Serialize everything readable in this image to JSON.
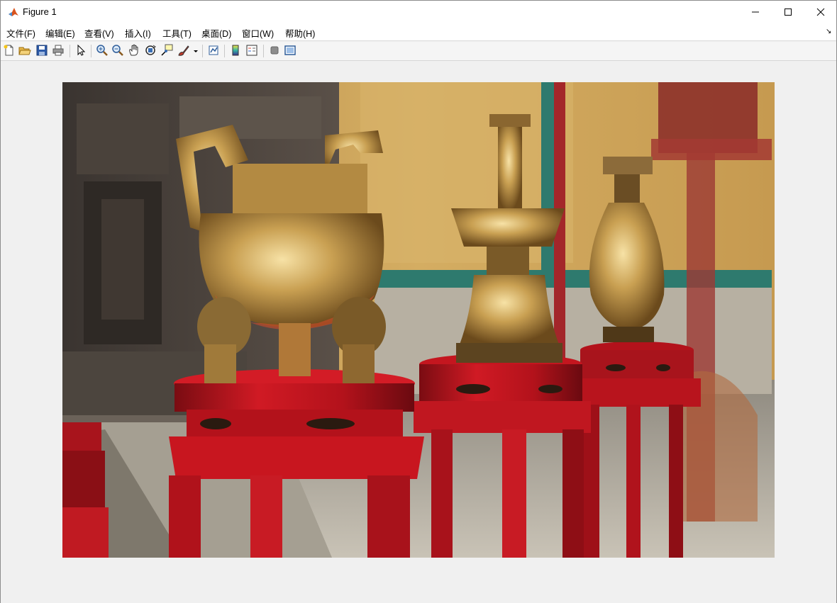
{
  "window": {
    "title": "Figure 1",
    "app_icon": "matlab-icon"
  },
  "menu": {
    "items": [
      {
        "label": "文件(F)"
      },
      {
        "label": "编辑(E)"
      },
      {
        "label": "查看(V)"
      },
      {
        "label": "插入(I)"
      },
      {
        "label": "工具(T)"
      },
      {
        "label": "桌面(D)"
      },
      {
        "label": "窗口(W)"
      },
      {
        "label": "帮助(H)"
      }
    ],
    "dock_arrow": "↘"
  },
  "toolbar": {
    "icons": [
      "new-figure-icon",
      "open-icon",
      "save-icon",
      "print-icon",
      "pointer-icon",
      "zoom-in-icon",
      "zoom-out-icon",
      "pan-icon",
      "rotate-3d-icon",
      "data-cursor-icon",
      "brush-icon",
      "link-plot-icon",
      "colorbar-icon",
      "legend-icon",
      "hide-plot-tools-icon",
      "show-plot-tools-icon"
    ]
  },
  "colors": {
    "accent_red": "#c0101c",
    "brass": "#b8863a",
    "wall": "#c9a25a"
  }
}
